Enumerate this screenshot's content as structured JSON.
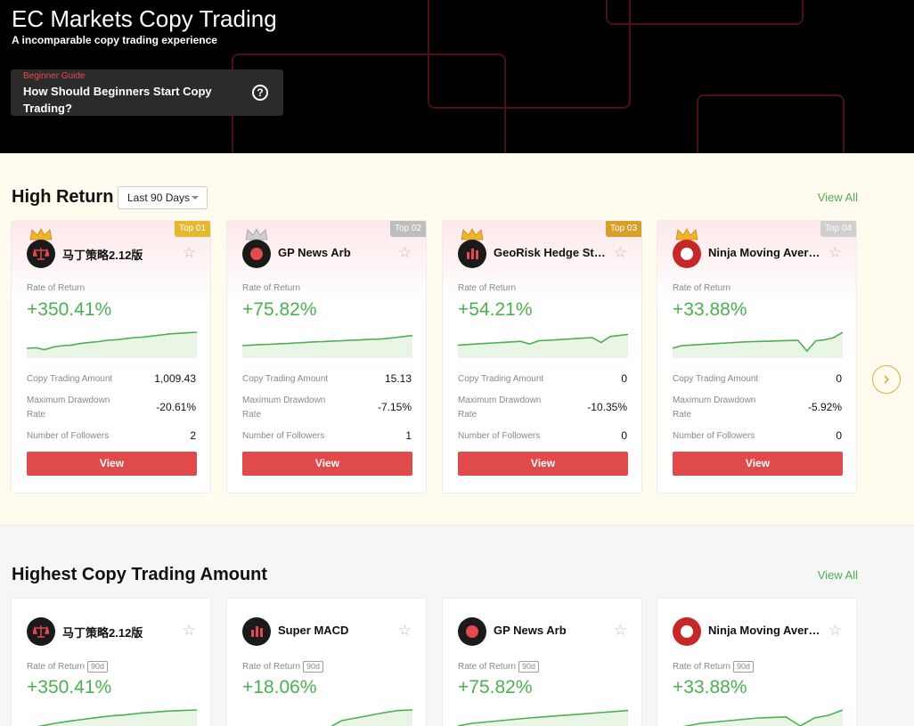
{
  "hero": {
    "title": "EC Markets Copy Trading",
    "subtitle": "A incomparable copy trading experience",
    "guide_tag": "Beginner Guide",
    "guide_text": "How Should Beginners Start Copy Trading?",
    "help_glyph": "?"
  },
  "section1": {
    "title": "High Return",
    "period": "Last 90 Days",
    "view_all": "View All",
    "cards": [
      {
        "rank": "Top 01",
        "rank_color": "#e6b830",
        "name": "马丁策略2.12版",
        "rr_label": "Rate of Return",
        "rr": "+350.41%",
        "amount_label": "Copy Trading Amount",
        "amount": "1,009.43",
        "dd_label": "Maximum Drawdown Rate",
        "dd": "-20.61%",
        "fol_label": "Number of Followers",
        "fol": "2",
        "view": "View",
        "spark": [
          0.3,
          0.32,
          0.25,
          0.35,
          0.4,
          0.42,
          0.48,
          0.52,
          0.55,
          0.6,
          0.62,
          0.66,
          0.7,
          0.72,
          0.76,
          0.8,
          0.84,
          0.86,
          0.88,
          0.9
        ]
      },
      {
        "rank": "Top 02",
        "rank_color": "#bdbdbd",
        "name": "GP News Arb",
        "rr_label": "Rate of Return",
        "rr": "+75.82%",
        "amount_label": "Copy Trading Amount",
        "amount": "15.13",
        "dd_label": "Maximum Drawdown Rate",
        "dd": "-7.15%",
        "fol_label": "Number of Followers",
        "fol": "1",
        "view": "View",
        "spark": [
          0.4,
          0.42,
          0.44,
          0.45,
          0.47,
          0.48,
          0.5,
          0.52,
          0.54,
          0.55,
          0.57,
          0.58,
          0.6,
          0.61,
          0.63,
          0.64,
          0.66,
          0.7,
          0.74,
          0.78
        ]
      },
      {
        "rank": "Top 03",
        "rank_color": "#d6a02a",
        "name": "GeoRisk Hedge Strategy",
        "rr_label": "Rate of Return",
        "rr": "+54.21%",
        "amount_label": "Copy Trading Amount",
        "amount": "0",
        "dd_label": "Maximum Drawdown Rate",
        "dd": "-10.35%",
        "fol_label": "Number of Followers",
        "fol": "0",
        "view": "View",
        "spark": [
          0.42,
          0.44,
          0.46,
          0.48,
          0.5,
          0.52,
          0.54,
          0.56,
          0.46,
          0.58,
          0.6,
          0.62,
          0.64,
          0.66,
          0.68,
          0.7,
          0.52,
          0.74,
          0.78,
          0.82
        ]
      },
      {
        "rank": "Top 04",
        "rank_color": "#cfcfcf",
        "name": "Ninja Moving Average",
        "rr_label": "Rate of Return",
        "rr": "+33.88%",
        "amount_label": "Copy Trading Amount",
        "amount": "0",
        "dd_label": "Maximum Drawdown Rate",
        "dd": "-5.92%",
        "fol_label": "Number of Followers",
        "fol": "0",
        "view": "View",
        "spark": [
          0.3,
          0.4,
          0.42,
          0.44,
          0.46,
          0.48,
          0.5,
          0.52,
          0.54,
          0.55,
          0.56,
          0.57,
          0.58,
          0.59,
          0.6,
          0.2,
          0.58,
          0.62,
          0.7,
          0.9
        ]
      }
    ]
  },
  "section2": {
    "title": "Highest Copy Trading Amount",
    "view_all": "View All",
    "cards": [
      {
        "name": "马丁策略2.12版",
        "rr_label": "Rate of Return",
        "rr_tag": "90d",
        "rr": "+350.41%",
        "spark": [
          0.2,
          0.3,
          0.4,
          0.48,
          0.55,
          0.62,
          0.68,
          0.72,
          0.78,
          0.82,
          0.86,
          0.88,
          0.9
        ]
      },
      {
        "name": "Super MACD",
        "rr_label": "Rate of Return",
        "rr_tag": "90d",
        "rr": "+18.06%",
        "spark": [
          0.1,
          0.12,
          0.14,
          0.15,
          0.16,
          0.18,
          0.2,
          0.5,
          0.6,
          0.7,
          0.8,
          0.88,
          0.9
        ]
      },
      {
        "name": "GP News Arb",
        "rr_label": "Rate of Return",
        "rr_tag": "90d",
        "rr": "+75.82%",
        "spark": [
          0.3,
          0.4,
          0.45,
          0.5,
          0.55,
          0.6,
          0.64,
          0.68,
          0.72,
          0.76,
          0.8,
          0.84,
          0.88
        ]
      },
      {
        "name": "Ninja Moving Average",
        "rr_label": "Rate of Return",
        "rr_tag": "90d",
        "rr": "+33.88%",
        "spark": [
          0.2,
          0.3,
          0.4,
          0.45,
          0.5,
          0.55,
          0.6,
          0.62,
          0.64,
          0.3,
          0.6,
          0.7,
          0.9
        ]
      }
    ]
  },
  "colors": {
    "accent_green": "#4caf50",
    "button_red": "#e04a4a",
    "drawdown_red": "#e5484d"
  }
}
